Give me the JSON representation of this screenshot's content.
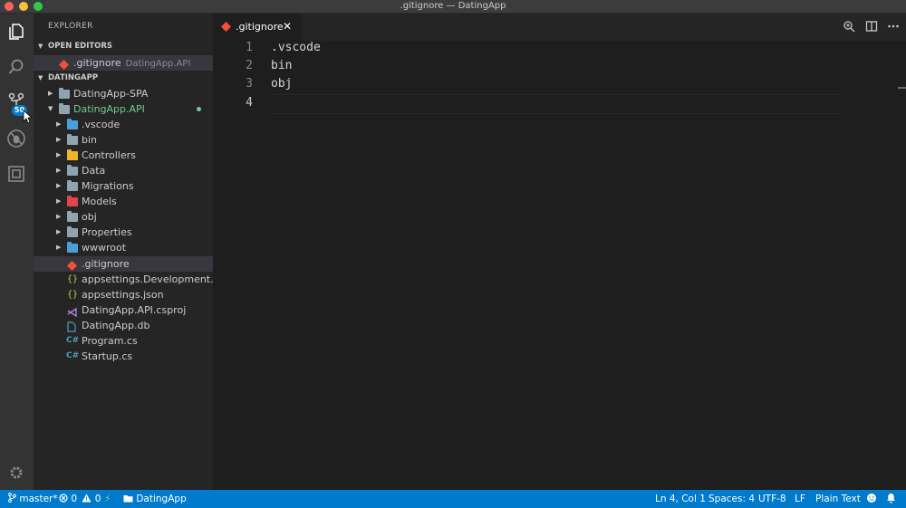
{
  "window": {
    "title": ".gitignore — DatingApp"
  },
  "activity_bar": {
    "scm_badge": "50"
  },
  "sidebar": {
    "title": "EXPLORER",
    "open_editors": {
      "header": "OPEN EDITORS",
      "items": [
        {
          "name": ".gitignore",
          "description": "DatingApp.API"
        }
      ]
    },
    "workspace": {
      "header": "DATINGAPP",
      "tree": [
        {
          "name": "DatingApp-SPA"
        },
        {
          "name": "DatingApp.API"
        },
        {
          "name": ".vscode"
        },
        {
          "name": "bin"
        },
        {
          "name": "Controllers"
        },
        {
          "name": "Data"
        },
        {
          "name": "Migrations"
        },
        {
          "name": "Models"
        },
        {
          "name": "obj"
        },
        {
          "name": "Properties"
        },
        {
          "name": "wwwroot"
        },
        {
          "name": ".gitignore"
        },
        {
          "name": "appsettings.Development.js..."
        },
        {
          "name": "appsettings.json"
        },
        {
          "name": "DatingApp.API.csproj"
        },
        {
          "name": "DatingApp.db"
        },
        {
          "name": "Program.cs"
        },
        {
          "name": "Startup.cs"
        }
      ]
    }
  },
  "editor": {
    "tab": {
      "label": ".gitignore",
      "close": "✕"
    },
    "lines": [
      {
        "number": "1",
        "text": ".vscode"
      },
      {
        "number": "2",
        "text": "bin"
      },
      {
        "number": "3",
        "text": "obj"
      },
      {
        "number": "4",
        "text": ""
      }
    ]
  },
  "status_bar": {
    "branch": "master*",
    "errors": "0",
    "warnings": "0",
    "folder": "DatingApp",
    "position": "Ln 4, Col 1",
    "spaces": "Spaces: 4",
    "encoding": "UTF-8",
    "eol": "LF",
    "language": "Plain Text"
  },
  "colors": {
    "accent": "#007acc",
    "git_icon": "#f05033",
    "json_icon": "#cbcb41",
    "csharp_icon": "#519aba",
    "csproj_icon": "#b180d7"
  }
}
